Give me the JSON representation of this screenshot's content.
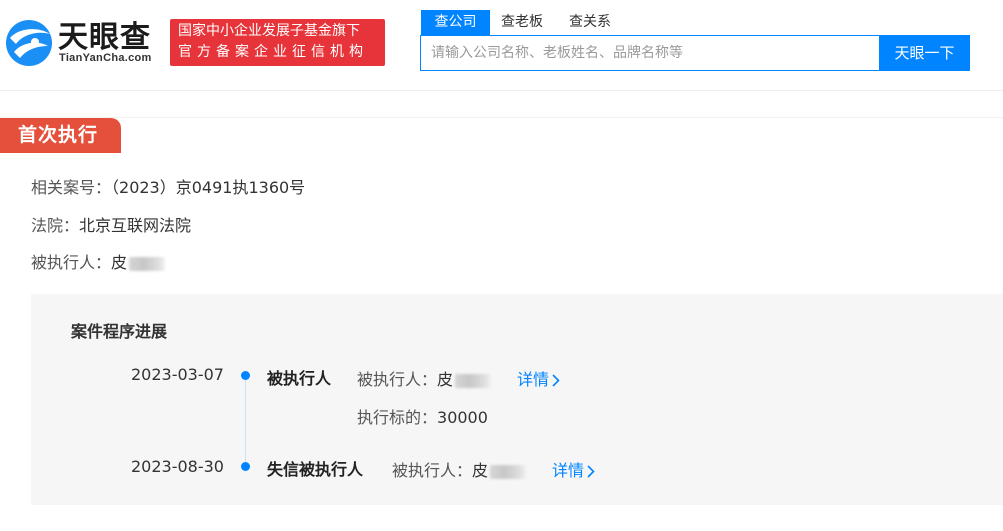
{
  "header": {
    "logo_name": "天眼查",
    "logo_sub": "TianYanCha.com",
    "badge_line1": "国家中小企业发展子基金旗下",
    "badge_line2": "官方备案企业征信机构",
    "search_tabs": [
      "查公司",
      "查老板",
      "查关系"
    ],
    "active_tab": 0,
    "search_placeholder": "请输入公司名称、老板姓名、品牌名称等",
    "search_value": "",
    "search_button": "天眼一下"
  },
  "section": {
    "tag": "首次执行",
    "rows": [
      {
        "label": "相关案号：",
        "value": "（2023）京0491执1360号"
      },
      {
        "label": "法院：",
        "value": "北京互联网法院"
      },
      {
        "label": "被执行人：",
        "value": "皮"
      }
    ]
  },
  "progress": {
    "title": "案件程序进展",
    "events": [
      {
        "date": "2023-03-07",
        "event": "被执行人",
        "detail_label": "被执行人：",
        "detail_value": "皮",
        "link": "详情",
        "extra_label": "执行标的：",
        "extra_value": "30000"
      },
      {
        "date": "2023-08-30",
        "event": "失信被执行人",
        "detail_label": "被执行人：",
        "detail_value": "皮",
        "link": "详情"
      }
    ]
  },
  "colors": {
    "accent": "#0084ff",
    "tag_red": "#e4503c",
    "badge_red": "#e7343a",
    "panel_bg": "#f6f6f6"
  },
  "icons": [
    "tianyancha-logo-icon",
    "chevron-right-icon"
  ]
}
